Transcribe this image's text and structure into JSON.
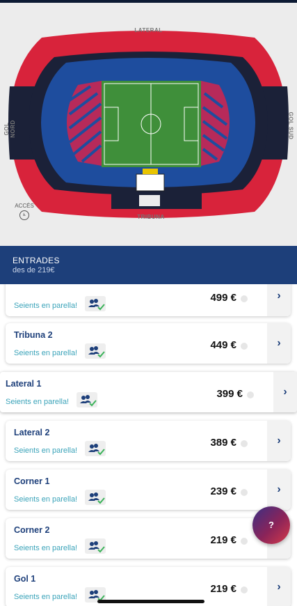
{
  "map": {
    "label_top": "LATERAL",
    "label_bottom": "TRIBUNA",
    "label_left": "GOL NORD",
    "label_right": "GOL SUD",
    "acces": "ACCÉS",
    "colors": {
      "ring_outer": "#d8233b",
      "ring_dark": "#1b2138",
      "seats_blue": "#1e4d9e",
      "pitch": "#3f8f3a"
    }
  },
  "header": {
    "title": "ENTRADES",
    "subtitle": "des de 219€"
  },
  "tickets": [
    {
      "name": "",
      "pair_text": "Seients en parella!",
      "price": "499 €"
    },
    {
      "name": "Tribuna 2",
      "pair_text": "Seients en parella!",
      "price": "449 €"
    },
    {
      "name": "Lateral 1",
      "pair_text": "Seients en parella!",
      "price": "399 €"
    },
    {
      "name": "Lateral 2",
      "pair_text": "Seients en parella!",
      "price": "389 €"
    },
    {
      "name": "Corner 1",
      "pair_text": "Seients en parella!",
      "price": "239 €"
    },
    {
      "name": "Corner 2",
      "pair_text": "Seients en parella!",
      "price": "219 €"
    },
    {
      "name": "Gol 1",
      "pair_text": "Seients en parella!",
      "price": "219 €"
    }
  ],
  "help_label": "?",
  "chevron": "›"
}
